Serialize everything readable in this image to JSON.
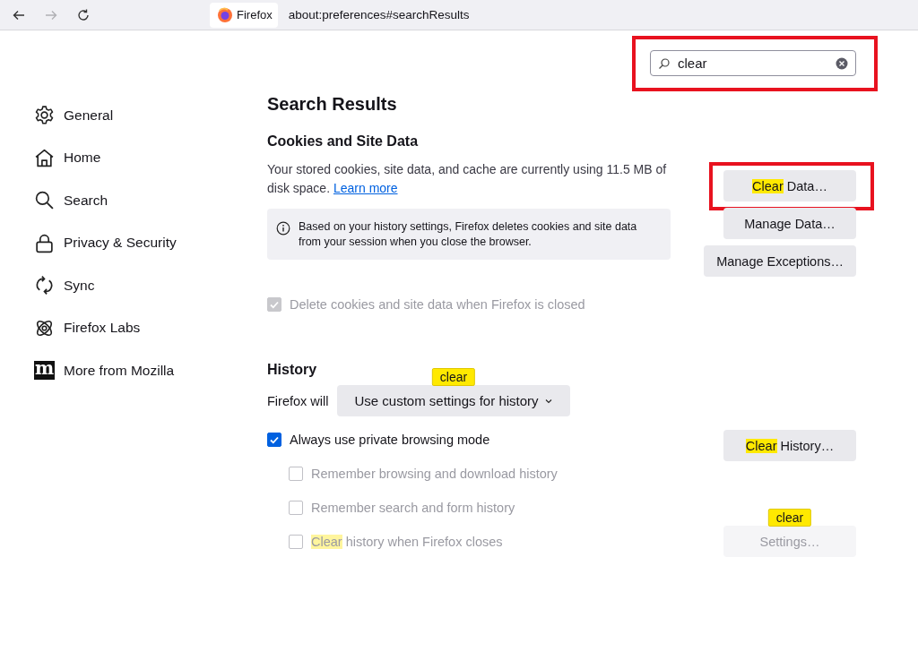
{
  "toolbar": {
    "nav_buttons": [
      {
        "kind": "back",
        "disabled": false
      },
      {
        "kind": "forward",
        "disabled": true
      },
      {
        "kind": "reload",
        "disabled": false
      }
    ],
    "identity_label": "Firefox",
    "url": "about:preferences#searchResults"
  },
  "search": {
    "value": "clear",
    "framed": true
  },
  "sidebar": {
    "items": [
      {
        "kind": "gear",
        "label": "General"
      },
      {
        "kind": "home",
        "label": "Home"
      },
      {
        "kind": "search",
        "label": "Search"
      },
      {
        "kind": "lock",
        "label": "Privacy & Security"
      },
      {
        "kind": "sync",
        "label": "Sync"
      },
      {
        "kind": "labs",
        "label": "Firefox Labs"
      },
      {
        "kind": "mozilla",
        "glyph": "m",
        "label": "More from Mozilla"
      }
    ]
  },
  "page_title": "Search Results",
  "cookies": {
    "title": "Cookies and Site Data",
    "description": "Your stored cookies, site data, and cache are currently using 11.5 MB of disk space.",
    "link": "Learn more",
    "info": "Based on your history settings, Firefox deletes cookies and site data from your session when you close the browser.",
    "checkbox": {
      "label": "Delete cookies and site data when Firefox is closed",
      "checked": true,
      "disabled": true
    },
    "buttons": [
      {
        "highlight": "Clear",
        "label": " Data…",
        "framed": true,
        "disabled": false
      },
      {
        "label": "Manage Data…",
        "framed": false,
        "disabled": false
      },
      {
        "label": "Manage Exceptions…",
        "framed": false,
        "disabled": false
      }
    ]
  },
  "history": {
    "title": "History",
    "mode_label": "Firefox will",
    "mode_select": "Use custom settings for history",
    "mode_tooltip": "clear",
    "checkboxes": [
      {
        "label": "Always use private browsing mode",
        "checked": true,
        "disabled": false,
        "nested": false
      },
      {
        "label": "Remember browsing and download history",
        "checked": false,
        "disabled": true,
        "nested": true
      },
      {
        "label": "Remember search and form history",
        "checked": false,
        "disabled": true,
        "nested": true
      },
      {
        "highlight": "Clear",
        "label": " history when Firefox closes",
        "checked": false,
        "disabled": true,
        "nested": true
      }
    ],
    "clear_button": {
      "highlight": "Clear",
      "label": " History…",
      "disabled": false
    },
    "settings_button": {
      "label": "Settings…",
      "disabled": true,
      "tooltip": "clear"
    }
  }
}
